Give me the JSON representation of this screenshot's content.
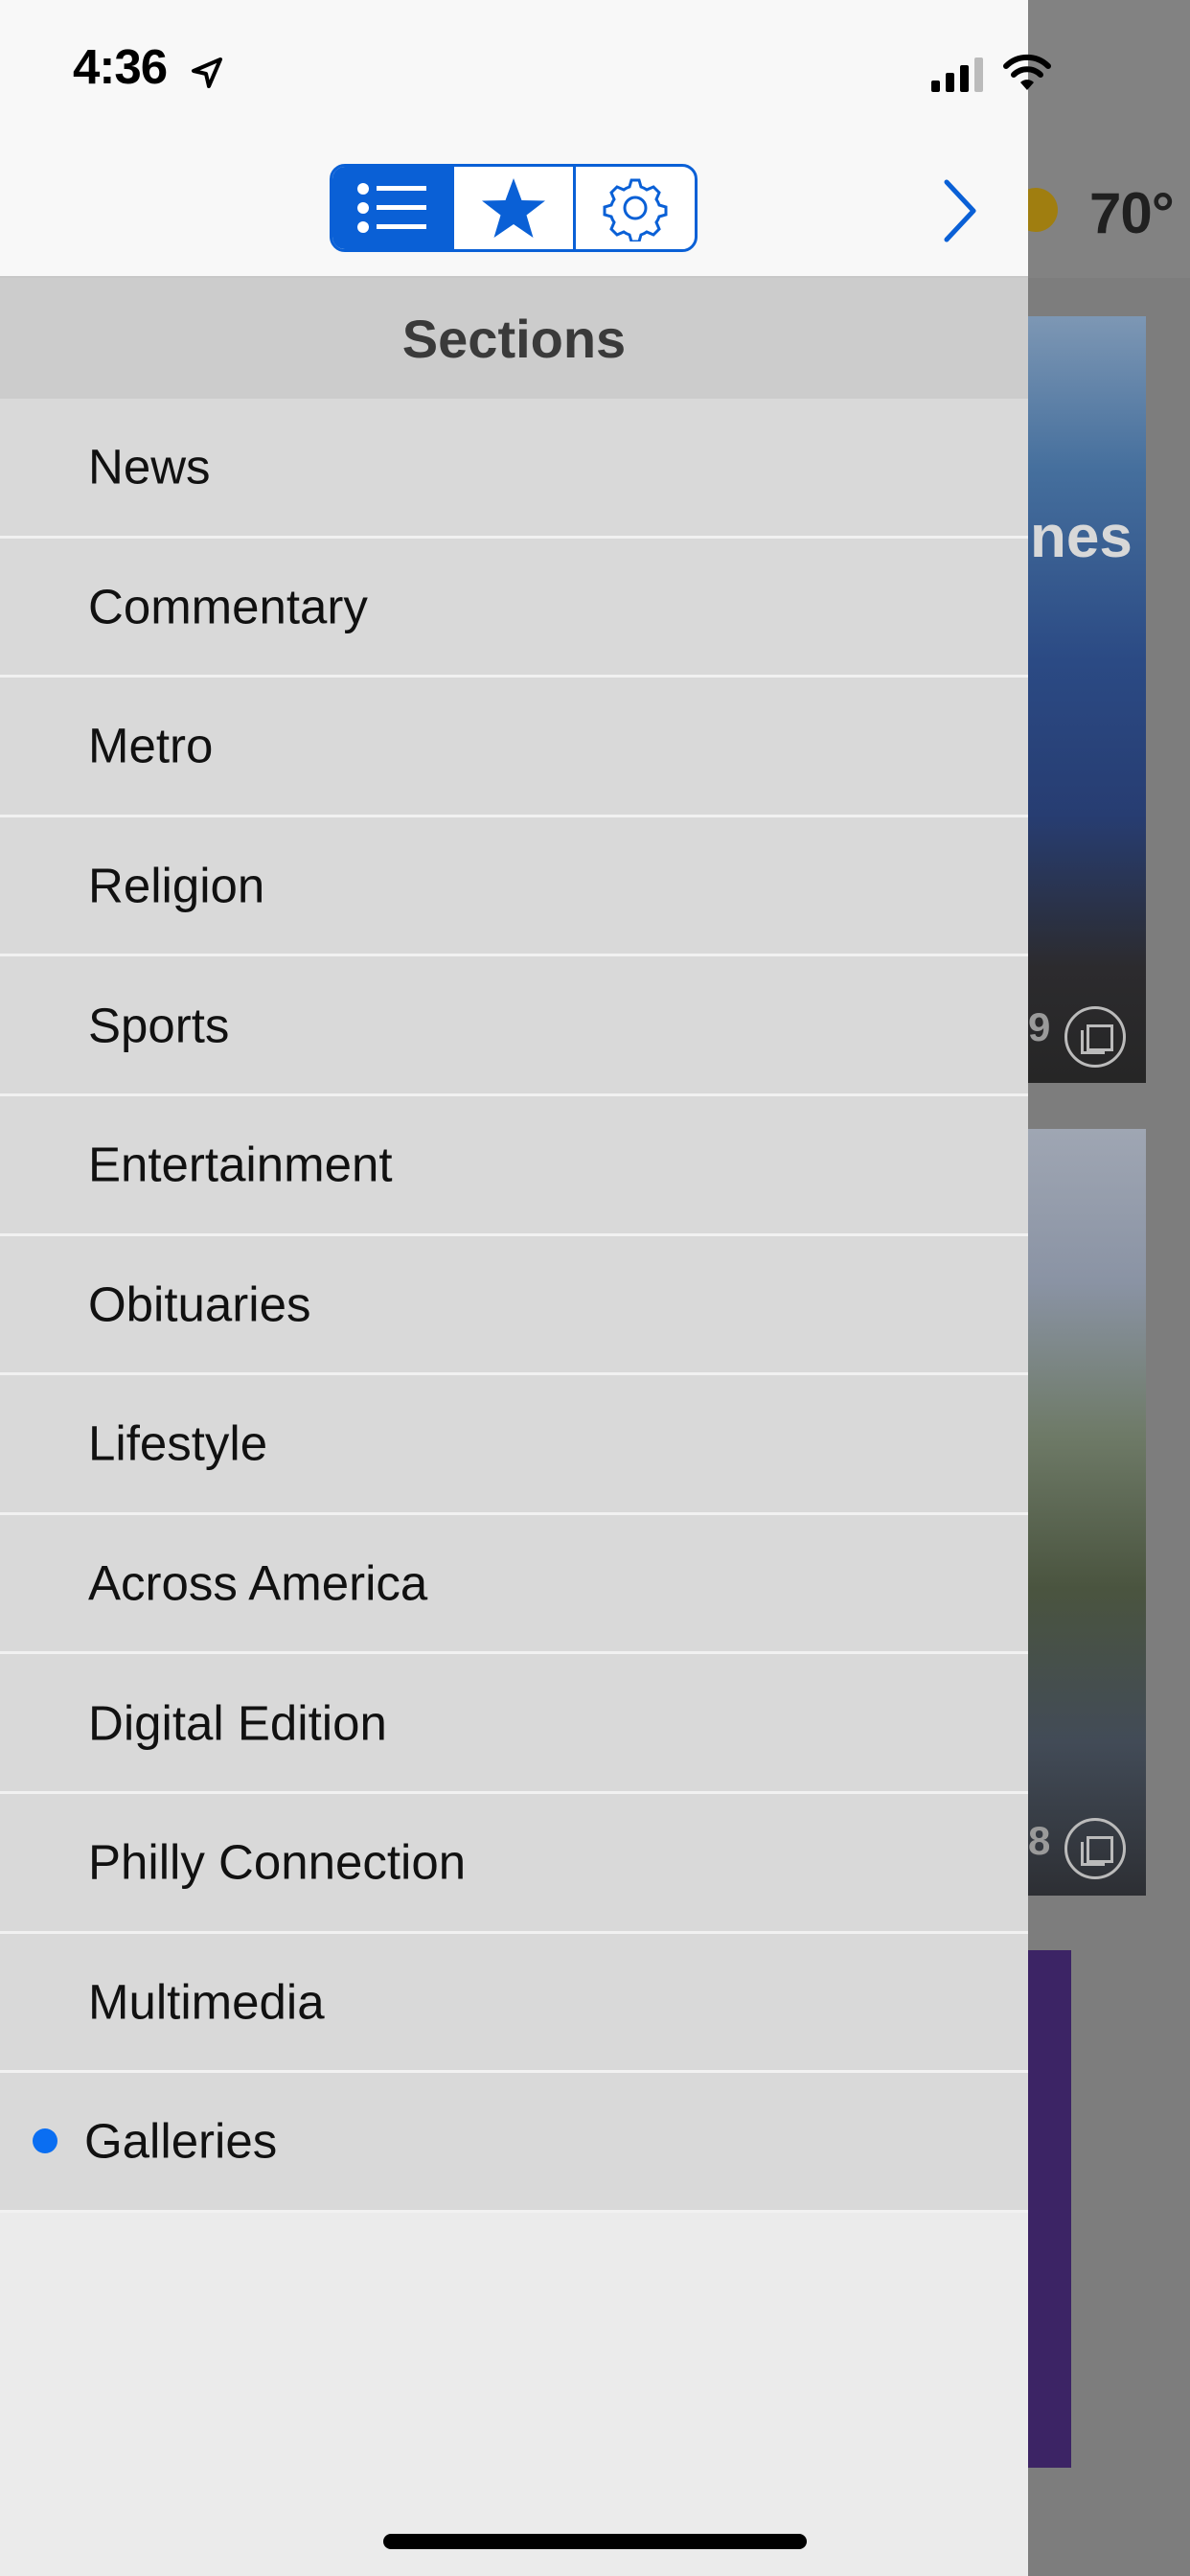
{
  "status_bar": {
    "time": "4:36"
  },
  "nav": {
    "segments": [
      {
        "icon": "list-icon",
        "active": true
      },
      {
        "icon": "star-icon",
        "active": false
      },
      {
        "icon": "gear-icon",
        "active": false
      }
    ],
    "next_icon": "chevron-right-icon"
  },
  "sections": {
    "title": "Sections",
    "items": [
      {
        "label": "News"
      },
      {
        "label": "Commentary"
      },
      {
        "label": "Metro"
      },
      {
        "label": "Religion"
      },
      {
        "label": "Sports"
      },
      {
        "label": "Entertainment"
      },
      {
        "label": "Obituaries"
      },
      {
        "label": "Lifestyle"
      },
      {
        "label": "Across America"
      },
      {
        "label": "Digital Edition"
      },
      {
        "label": "Philly Connection"
      },
      {
        "label": "Multimedia"
      },
      {
        "label": "Galleries",
        "selected": true
      }
    ]
  },
  "background": {
    "temperature": "70°",
    "card_1_title_fragment": "nes",
    "card_1_count_fragment": "9",
    "card_2_count_fragment": "8"
  },
  "colors": {
    "accent": "#0a60d6",
    "selected_dot": "#0a6ef2"
  }
}
